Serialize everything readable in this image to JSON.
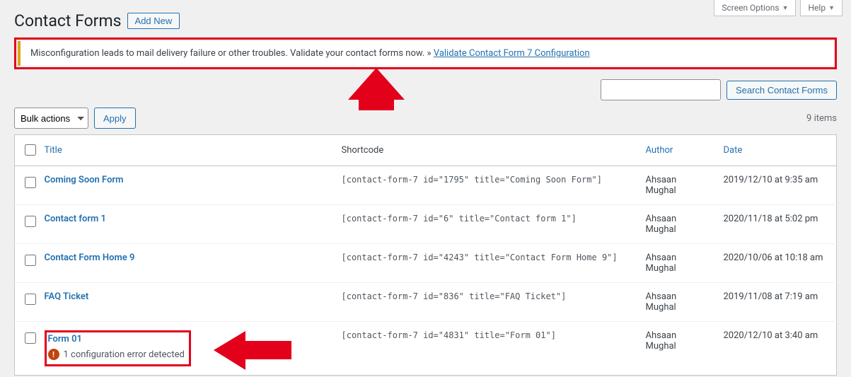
{
  "screen_meta": {
    "screen_options": "Screen Options",
    "help": "Help"
  },
  "heading": {
    "title": "Contact Forms",
    "add_new": "Add New"
  },
  "notice": {
    "text": "Misconfiguration leads to mail delivery failure or other troubles. Validate your contact forms now. » ",
    "link": "Validate Contact Form 7 Configuration"
  },
  "search": {
    "placeholder": "",
    "button": "Search Contact Forms"
  },
  "tablenav": {
    "bulk_label": "Bulk actions",
    "apply": "Apply",
    "count": "9 items"
  },
  "columns": {
    "title": "Title",
    "shortcode": "Shortcode",
    "author": "Author",
    "date": "Date"
  },
  "rows": [
    {
      "title": "Coming Soon Form",
      "shortcode": "[contact-form-7 id=\"1795\" title=\"Coming Soon Form\"]",
      "author": "Ahsaan Mughal",
      "date": "2019/12/10 at 9:35 am"
    },
    {
      "title": "Contact form 1",
      "shortcode": "[contact-form-7 id=\"6\" title=\"Contact form 1\"]",
      "author": "Ahsaan Mughal",
      "date": "2020/11/18 at 5:02 pm"
    },
    {
      "title": "Contact Form Home 9",
      "shortcode": "[contact-form-7 id=\"4243\" title=\"Contact Form Home 9\"]",
      "author": "Ahsaan Mughal",
      "date": "2020/10/06 at 10:18 am"
    },
    {
      "title": "FAQ Ticket",
      "shortcode": "[contact-form-7 id=\"836\" title=\"FAQ Ticket\"]",
      "author": "Ahsaan Mughal",
      "date": "2019/11/08 at 7:19 am"
    },
    {
      "title": "Form 01",
      "shortcode": "[contact-form-7 id=\"4831\" title=\"Form 01\"]",
      "author": "Ahsaan Mughal",
      "date": "2020/12/10 at 3:40 am",
      "error": "1 configuration error detected"
    }
  ]
}
